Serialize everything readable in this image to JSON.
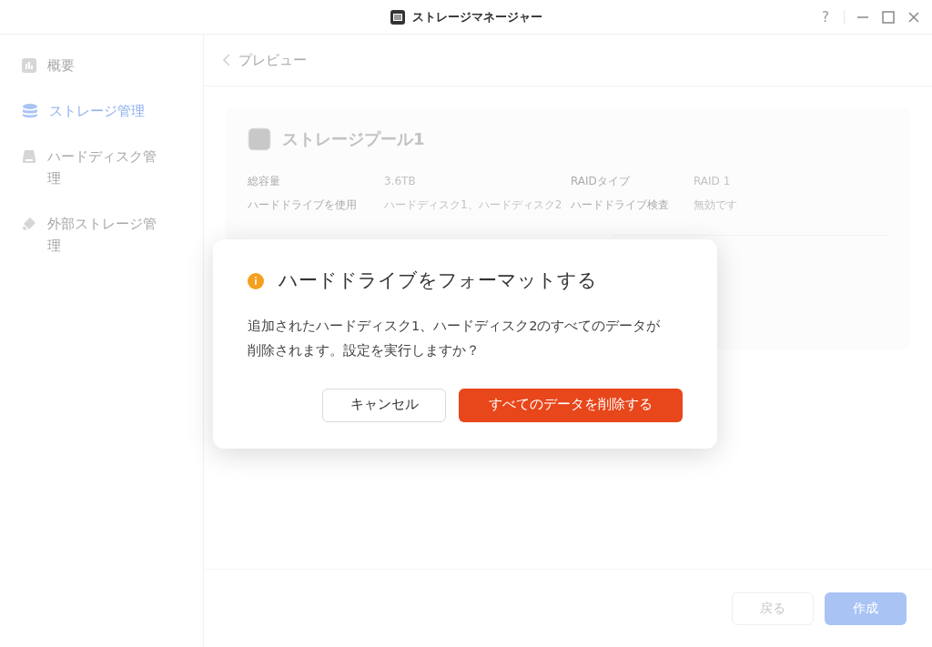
{
  "window": {
    "title": "ストレージマネージャー",
    "controls": [
      "?"
    ]
  },
  "sidebar": {
    "items": [
      {
        "label": "概要",
        "selected": false
      },
      {
        "label": "ストレージ管理",
        "selected": true
      },
      {
        "label": "ハードディスク管理",
        "selected": false
      },
      {
        "label": "外部ストレージ管理",
        "selected": false
      }
    ]
  },
  "header": {
    "back_label": "プレビュー"
  },
  "pool": {
    "title": "ストレージプール1",
    "fields": [
      {
        "label": "総容量",
        "value": "3.6TB"
      },
      {
        "label": "RAIDタイプ",
        "value": "RAID 1"
      },
      {
        "label": "ハードドライブを使用",
        "value": "ハードディスク1、ハードディスク2"
      },
      {
        "label": "ハードドライブ検査",
        "value": "無効です"
      }
    ]
  },
  "footer": {
    "buttons": [
      {
        "label": "戻る",
        "kind": "secondary"
      },
      {
        "label": "作成",
        "kind": "primary"
      }
    ]
  },
  "dialog": {
    "title": "ハードドライブをフォーマットする",
    "message": "追加されたハードディスク1、ハードディスク2のすべてのデータが削除されます。設定を実行しますか？",
    "buttons": [
      {
        "label": "キャンセル",
        "kind": "secondary"
      },
      {
        "label": "すべてのデータを削除する",
        "kind": "danger"
      }
    ]
  }
}
